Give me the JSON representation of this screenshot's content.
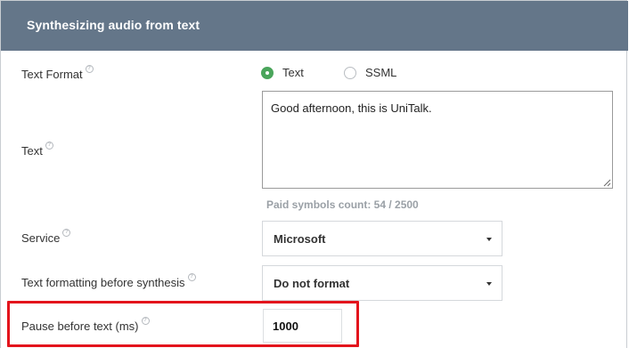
{
  "header": {
    "title": "Synthesizing audio from text"
  },
  "help_glyph": "?",
  "text_format": {
    "label": "Text Format",
    "options": [
      {
        "label": "Text",
        "checked": true
      },
      {
        "label": "SSML",
        "checked": false
      }
    ]
  },
  "text": {
    "label": "Text",
    "value": "Good afternoon, this is UniTalk.",
    "symbols_count": "Paid symbols count: 54 / 2500"
  },
  "service": {
    "label": "Service",
    "selected": "Microsoft"
  },
  "formatting": {
    "label": "Text formatting before synthesis",
    "selected": "Do not format"
  },
  "pause": {
    "label": "Pause before text (ms)",
    "value": "1000"
  },
  "colors": {
    "header_bg": "#647689",
    "radio_checked": "#4aa55b",
    "highlight": "#e3141c"
  }
}
